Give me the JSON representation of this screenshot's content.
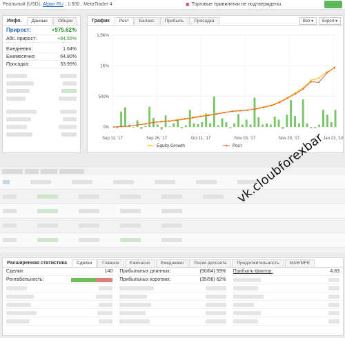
{
  "topbar": {
    "account_type": "Реальный (USD),",
    "broker": "Alpari RU",
    "leverage_platform": ", 1:500 , MetaTrader 4",
    "warning": "Торговые привилегии не подтверждены."
  },
  "info_panel": {
    "title": "Инфо.",
    "tabs": [
      "Данные",
      "Общие"
    ],
    "growth_label": "Прирост:",
    "growth_value": "+975.62%",
    "abs_growth_label": "Абс. прирост:",
    "abs_growth_value": "+84.55%",
    "rows": [
      {
        "label": "Ежедневно:",
        "value": "1.64%"
      },
      {
        "label": "Ежемесячно:",
        "value": "64.80%"
      },
      {
        "label": "Просадка:",
        "value": "33.95%"
      }
    ]
  },
  "chart_panel": {
    "title": "График",
    "tabs": [
      "Рост",
      "Баланс",
      "Прибыль",
      "Просадка"
    ],
    "tools": [
      "Всё",
      "Export"
    ]
  },
  "chart_data": {
    "type": "line",
    "x_ticks": [
      "Sep 11, '17",
      "Sep 26, '17",
      "Oct 11, '17",
      "Nov 03, '17",
      "Nov 29, '17",
      "Jan 23, '18"
    ],
    "y_ticks": [
      "0%",
      "500%",
      "1K%",
      "1.5K%"
    ],
    "ylim": [
      -100,
      1500
    ],
    "legend_placement": "bottom",
    "series": [
      {
        "name": "Equity Growth",
        "color": "#f0c419",
        "values": [
          0,
          10,
          15,
          40,
          55,
          80,
          90,
          100,
          120,
          140,
          160,
          180,
          200,
          215,
          240,
          260,
          270,
          280,
          300,
          330,
          360,
          410,
          480,
          560,
          640,
          760,
          800,
          900,
          960
        ]
      },
      {
        "name": "Рост",
        "color": "#e8632f",
        "values": [
          0,
          8,
          14,
          35,
          50,
          75,
          85,
          95,
          110,
          130,
          150,
          170,
          190,
          210,
          235,
          255,
          265,
          275,
          295,
          320,
          350,
          400,
          470,
          540,
          620,
          740,
          730,
          880,
          975
        ]
      }
    ],
    "bar_values": [
      0,
      -20,
      250,
      320,
      40,
      -10,
      110,
      -30,
      20,
      330,
      150,
      40,
      -40,
      190,
      10,
      60,
      130,
      -20,
      30,
      280,
      60,
      50,
      80,
      220,
      60,
      500,
      30,
      140,
      80,
      -20,
      60,
      210,
      40,
      120,
      40,
      480,
      160,
      40,
      60,
      40,
      170,
      120,
      -30,
      200,
      440,
      180,
      60,
      450,
      60,
      -20,
      -20,
      40,
      280,
      200,
      80,
      280
    ]
  },
  "extended": {
    "title": "Расширенная статистика",
    "tabs": [
      "Сделки",
      "Главное",
      "Ежечасно",
      "Ежедневно",
      "Риски депозита",
      "Продолжительность",
      "MAE/MFE"
    ],
    "trades_label": "Сделки:",
    "trades_value": "140",
    "profitability_label": "Рентабельность:",
    "profitability_green": 0.59,
    "long_label": "Прибыльных длинных:",
    "long_value": "(50/84) 59%",
    "short_label": "Прибыльных коротких:",
    "short_value": "(35/56) 62%",
    "pf_label": "Прибыль-фактор:",
    "pf_value": "4.83"
  },
  "watermark": "vk.cloubforexbar",
  "colors": {
    "green": "#5cb85c",
    "accent": "#2a6ebb",
    "bar": "#7cc66a",
    "line": "#e8632f",
    "equity": "#f0c419"
  }
}
